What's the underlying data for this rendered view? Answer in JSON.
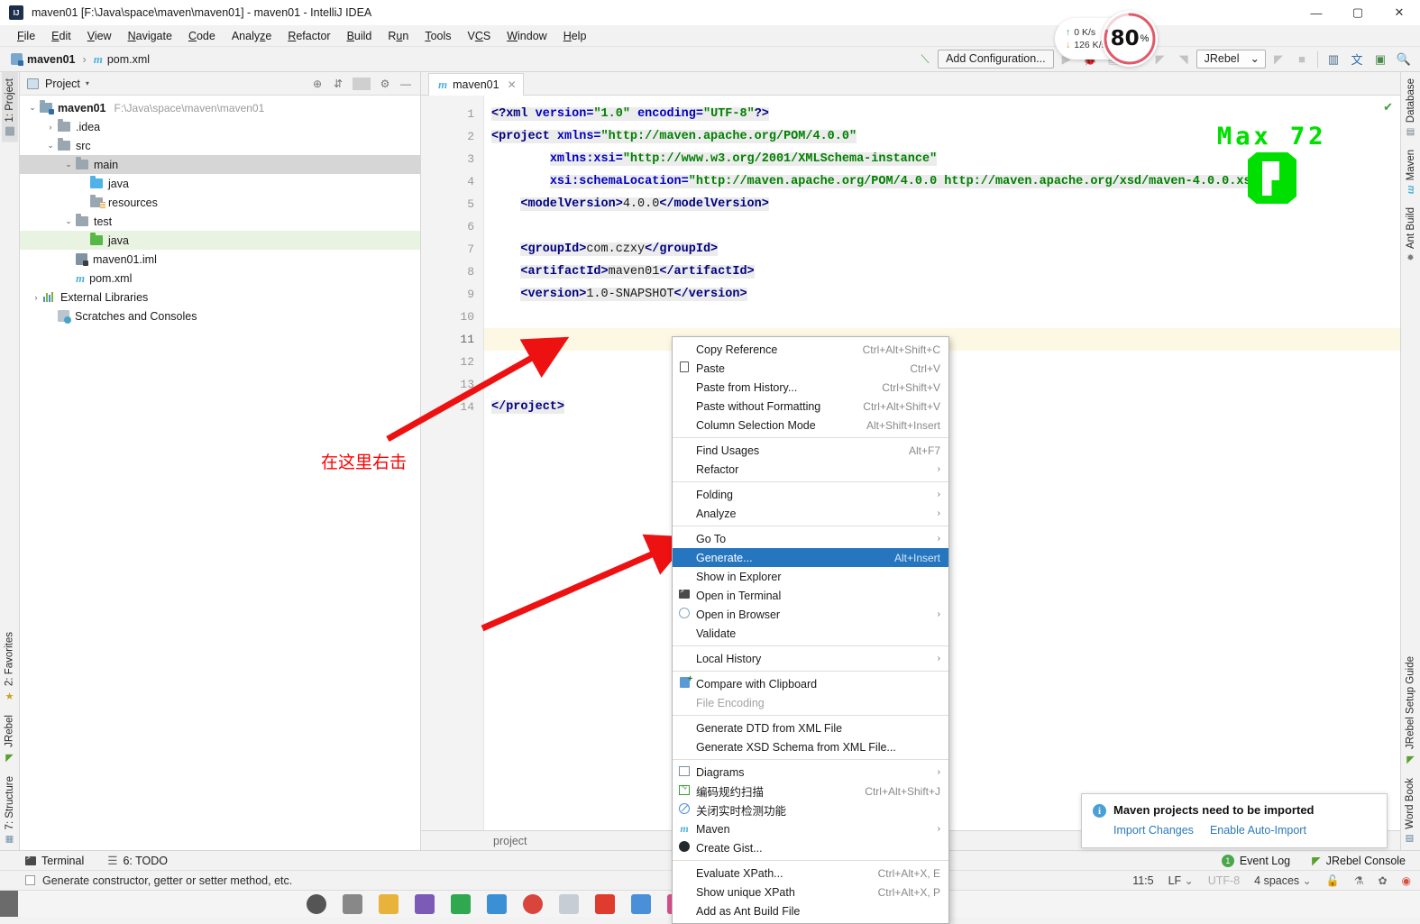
{
  "window": {
    "title": "maven01 [F:\\Java\\space\\maven\\maven01] - maven01 - IntelliJ IDEA",
    "minimize": "—",
    "maximize": "▢",
    "close": "✕"
  },
  "menubar": {
    "items": [
      "File",
      "Edit",
      "View",
      "Navigate",
      "Code",
      "Analyze",
      "Refactor",
      "Build",
      "Run",
      "Tools",
      "VCS",
      "Window",
      "Help"
    ]
  },
  "navbar": {
    "crumbs": [
      "maven01",
      "pom.xml"
    ],
    "separator": "›",
    "add_configuration": "Add Configuration...",
    "jrebel_select": "JRebel",
    "jrebel_caret": "⌄"
  },
  "net_widget": {
    "upload": "0   K/s",
    "download": "126 K/s",
    "up_arrow": "↑",
    "down_arrow": "↓",
    "gauge_value": "80",
    "gauge_unit": "%",
    "gauge_color": "#e05a6a"
  },
  "left_strip": {
    "top": [
      {
        "label": "1: Project",
        "icon": "project-icon",
        "active": true
      }
    ],
    "bottom": [
      {
        "label": "2: Favorites",
        "icon": "star-icon"
      },
      {
        "label": "JRebel",
        "icon": "jrebel-icon"
      },
      {
        "label": "7: Structure",
        "icon": "structure-icon"
      }
    ]
  },
  "right_strip": {
    "top": [
      {
        "label": "Database",
        "icon": "database-icon"
      },
      {
        "label": "Maven",
        "icon": "maven-icon"
      },
      {
        "label": "Ant Build",
        "icon": "ant-icon"
      }
    ],
    "bottom": [
      {
        "label": "JRebel Setup Guide",
        "icon": "jrebel-icon"
      },
      {
        "label": "Word Book",
        "icon": "book-icon"
      }
    ]
  },
  "project_panel": {
    "title": "Project",
    "caret": "▾",
    "tools": [
      "locate-icon",
      "collapse-all-icon",
      "gear-icon",
      "hide-icon"
    ],
    "tree": [
      {
        "indent": 0,
        "arrow": "⌄",
        "icon": "module-folder",
        "label": "maven01",
        "bold": true,
        "path": "F:\\Java\\space\\maven\\maven01",
        "state": "none"
      },
      {
        "indent": 1,
        "arrow": "›",
        "icon": "folder",
        "label": ".idea",
        "bold": false,
        "path": "",
        "state": "none"
      },
      {
        "indent": 1,
        "arrow": "⌄",
        "icon": "folder",
        "label": "src",
        "bold": false,
        "path": "",
        "state": "none"
      },
      {
        "indent": 2,
        "arrow": "⌄",
        "icon": "folder",
        "label": "main",
        "bold": false,
        "path": "",
        "state": "sel-grey"
      },
      {
        "indent": 3,
        "arrow": "",
        "icon": "folder-blue",
        "label": "java",
        "bold": false,
        "path": "",
        "state": "none"
      },
      {
        "indent": 3,
        "arrow": "",
        "icon": "folder-res",
        "label": "resources",
        "bold": false,
        "path": "",
        "state": "none"
      },
      {
        "indent": 2,
        "arrow": "⌄",
        "icon": "folder",
        "label": "test",
        "bold": false,
        "path": "",
        "state": "none"
      },
      {
        "indent": 3,
        "arrow": "",
        "icon": "folder-green",
        "label": "java",
        "bold": false,
        "path": "",
        "state": "sel-green"
      },
      {
        "indent": 2,
        "arrow": "",
        "icon": "iml-file",
        "label": "maven01.iml",
        "bold": false,
        "path": "",
        "state": "none"
      },
      {
        "indent": 2,
        "arrow": "",
        "icon": "maven-file",
        "label": "pom.xml",
        "bold": false,
        "path": "",
        "state": "none"
      },
      {
        "indent": 0,
        "arrow": "›",
        "icon": "library",
        "label": "External Libraries",
        "bold": false,
        "path": "",
        "state": "none"
      },
      {
        "indent": 1,
        "arrow": "",
        "icon": "scratches",
        "label": "Scratches and Consoles",
        "bold": false,
        "path": "",
        "state": "none"
      }
    ]
  },
  "editor": {
    "tab": {
      "label": "maven01",
      "close": "✕",
      "icon": "maven-file-icon"
    },
    "breadcrumb": "project",
    "inspection_mark": "✔",
    "lines": [
      {
        "n": "1",
        "current": false
      },
      {
        "n": "2",
        "current": false
      },
      {
        "n": "3",
        "current": false
      },
      {
        "n": "4",
        "current": false
      },
      {
        "n": "5",
        "current": false
      },
      {
        "n": "6",
        "current": false
      },
      {
        "n": "7",
        "current": false
      },
      {
        "n": "8",
        "current": false
      },
      {
        "n": "9",
        "current": false
      },
      {
        "n": "10",
        "current": false
      },
      {
        "n": "11",
        "current": true
      },
      {
        "n": "12",
        "current": false
      },
      {
        "n": "13",
        "current": false
      },
      {
        "n": "14",
        "current": false
      }
    ],
    "code": {
      "l1_pi_open": "<?xml",
      "l1_attr_version": "version=",
      "l1_val_version": "\"1.0\"",
      "l1_attr_encoding": "encoding=",
      "l1_val_encoding": "\"UTF-8\"",
      "l1_pi_close": "?>",
      "l2_tag": "<project",
      "l2_attr": "xmlns=",
      "l2_val": "\"http://maven.apache.org/POM/4.0.0\"",
      "l3_attr": "xmlns:xsi=",
      "l3_val": "\"http://www.w3.org/2001/XMLSchema-instance\"",
      "l4_attr": "xsi:schemaLocation=",
      "l4_val": "\"http://maven.apache.org/POM/4.0.0 http://maven.apache.org/xsd/maven-4.0.0.xsd\"",
      "l5_open": "<modelVersion>",
      "l5_text": "4.0.0",
      "l5_close": "</modelVersion>",
      "l7_open": "<groupId>",
      "l7_text": "com.czxy",
      "l7_close": "</groupId>",
      "l8_open": "<artifactId>",
      "l8_text": "maven01",
      "l8_close": "</artifactId>",
      "l9_open": "<version>",
      "l9_text": "1.0-SNAPSHOT",
      "l9_close": "</version>",
      "l14_close": "</project>"
    }
  },
  "overlay": {
    "max_text": "Max 72",
    "max_color": "#00e000",
    "annotation_text": "在这里右击",
    "annotation_color": "#ff0000"
  },
  "context_menu": {
    "items": [
      {
        "type": "item",
        "icon": "",
        "label": "Copy Reference",
        "accel": "Ctrl+Alt+Shift+C",
        "submenu": false,
        "selected": false,
        "disabled": false
      },
      {
        "type": "item",
        "icon": "paste-icon",
        "label": "Paste",
        "accel": "Ctrl+V",
        "submenu": false,
        "selected": false,
        "disabled": false
      },
      {
        "type": "item",
        "icon": "",
        "label": "Paste from History...",
        "accel": "Ctrl+Shift+V",
        "submenu": false,
        "selected": false,
        "disabled": false
      },
      {
        "type": "item",
        "icon": "",
        "label": "Paste without Formatting",
        "accel": "Ctrl+Alt+Shift+V",
        "submenu": false,
        "selected": false,
        "disabled": false
      },
      {
        "type": "item",
        "icon": "",
        "label": "Column Selection Mode",
        "accel": "Alt+Shift+Insert",
        "submenu": false,
        "selected": false,
        "disabled": false
      },
      {
        "type": "sep"
      },
      {
        "type": "item",
        "icon": "",
        "label": "Find Usages",
        "accel": "Alt+F7",
        "submenu": false,
        "selected": false,
        "disabled": false
      },
      {
        "type": "item",
        "icon": "",
        "label": "Refactor",
        "accel": "",
        "submenu": true,
        "selected": false,
        "disabled": false
      },
      {
        "type": "sep"
      },
      {
        "type": "item",
        "icon": "",
        "label": "Folding",
        "accel": "",
        "submenu": true,
        "selected": false,
        "disabled": false
      },
      {
        "type": "item",
        "icon": "",
        "label": "Analyze",
        "accel": "",
        "submenu": true,
        "selected": false,
        "disabled": false
      },
      {
        "type": "sep"
      },
      {
        "type": "item",
        "icon": "",
        "label": "Go To",
        "accel": "",
        "submenu": true,
        "selected": false,
        "disabled": false
      },
      {
        "type": "item",
        "icon": "",
        "label": "Generate...",
        "accel": "Alt+Insert",
        "submenu": false,
        "selected": true,
        "disabled": false
      },
      {
        "type": "item",
        "icon": "",
        "label": "Show in Explorer",
        "accel": "",
        "submenu": false,
        "selected": false,
        "disabled": false
      },
      {
        "type": "item",
        "icon": "terminal-icon",
        "label": "Open in Terminal",
        "accel": "",
        "submenu": false,
        "selected": false,
        "disabled": false
      },
      {
        "type": "item",
        "icon": "globe-icon",
        "label": "Open in Browser",
        "accel": "",
        "submenu": true,
        "selected": false,
        "disabled": false
      },
      {
        "type": "item",
        "icon": "",
        "label": "Validate",
        "accel": "",
        "submenu": false,
        "selected": false,
        "disabled": false
      },
      {
        "type": "sep"
      },
      {
        "type": "item",
        "icon": "",
        "label": "Local History",
        "accel": "",
        "submenu": true,
        "selected": false,
        "disabled": false
      },
      {
        "type": "sep"
      },
      {
        "type": "item",
        "icon": "compare-icon",
        "label": "Compare with Clipboard",
        "accel": "",
        "submenu": false,
        "selected": false,
        "disabled": false
      },
      {
        "type": "item",
        "icon": "",
        "label": "File Encoding",
        "accel": "",
        "submenu": false,
        "selected": false,
        "disabled": true
      },
      {
        "type": "sep"
      },
      {
        "type": "item",
        "icon": "",
        "label": "Generate DTD from XML File",
        "accel": "",
        "submenu": false,
        "selected": false,
        "disabled": false
      },
      {
        "type": "item",
        "icon": "",
        "label": "Generate XSD Schema from XML File...",
        "accel": "",
        "submenu": false,
        "selected": false,
        "disabled": false
      },
      {
        "type": "sep"
      },
      {
        "type": "item",
        "icon": "diagram-icon",
        "label": "Diagrams",
        "accel": "",
        "submenu": true,
        "selected": false,
        "disabled": false
      },
      {
        "type": "item",
        "icon": "scan-icon",
        "label": "编码规约扫描",
        "accel": "Ctrl+Alt+Shift+J",
        "submenu": false,
        "selected": false,
        "disabled": false
      },
      {
        "type": "item",
        "icon": "ban-icon",
        "label": "关闭实时检测功能",
        "accel": "",
        "submenu": false,
        "selected": false,
        "disabled": false
      },
      {
        "type": "item",
        "icon": "maven-icon",
        "label": "Maven",
        "accel": "",
        "submenu": true,
        "selected": false,
        "disabled": false
      },
      {
        "type": "item",
        "icon": "github-icon",
        "label": "Create Gist...",
        "accel": "",
        "submenu": false,
        "selected": false,
        "disabled": false
      },
      {
        "type": "sep"
      },
      {
        "type": "item",
        "icon": "",
        "label": "Evaluate XPath...",
        "accel": "Ctrl+Alt+X, E",
        "submenu": false,
        "selected": false,
        "disabled": false
      },
      {
        "type": "item",
        "icon": "",
        "label": "Show unique XPath",
        "accel": "Ctrl+Alt+X, P",
        "submenu": false,
        "selected": false,
        "disabled": false
      },
      {
        "type": "item",
        "icon": "",
        "label": "Add as Ant Build File",
        "accel": "",
        "submenu": false,
        "selected": false,
        "disabled": false
      }
    ],
    "submenu_arrow": "›",
    "selected_bg": "#2675bf"
  },
  "notification": {
    "icon": "info-icon",
    "title": "Maven projects need to be imported",
    "links": [
      "Import Changes",
      "Enable Auto-Import"
    ]
  },
  "bottom_strip": {
    "left": [
      {
        "label": "Terminal",
        "icon": "terminal-icon"
      },
      {
        "label": "6: TODO",
        "icon": "todo-icon"
      }
    ],
    "right": [
      {
        "label": "Event Log",
        "icon": "event-log-icon",
        "badge": "1"
      },
      {
        "label": "JRebel Console",
        "icon": "jrebel-icon"
      }
    ]
  },
  "status_bar": {
    "hint": "Generate constructor, getter or setter method, etc.",
    "caret_position": "11:5",
    "line_separator": "LF",
    "encoding": "UTF-8",
    "indent": "4 spaces",
    "separator_caret": "⌄",
    "icons": [
      "lock-icon",
      "inspection-icon",
      "analyze-icon",
      "chrome-icon"
    ]
  }
}
